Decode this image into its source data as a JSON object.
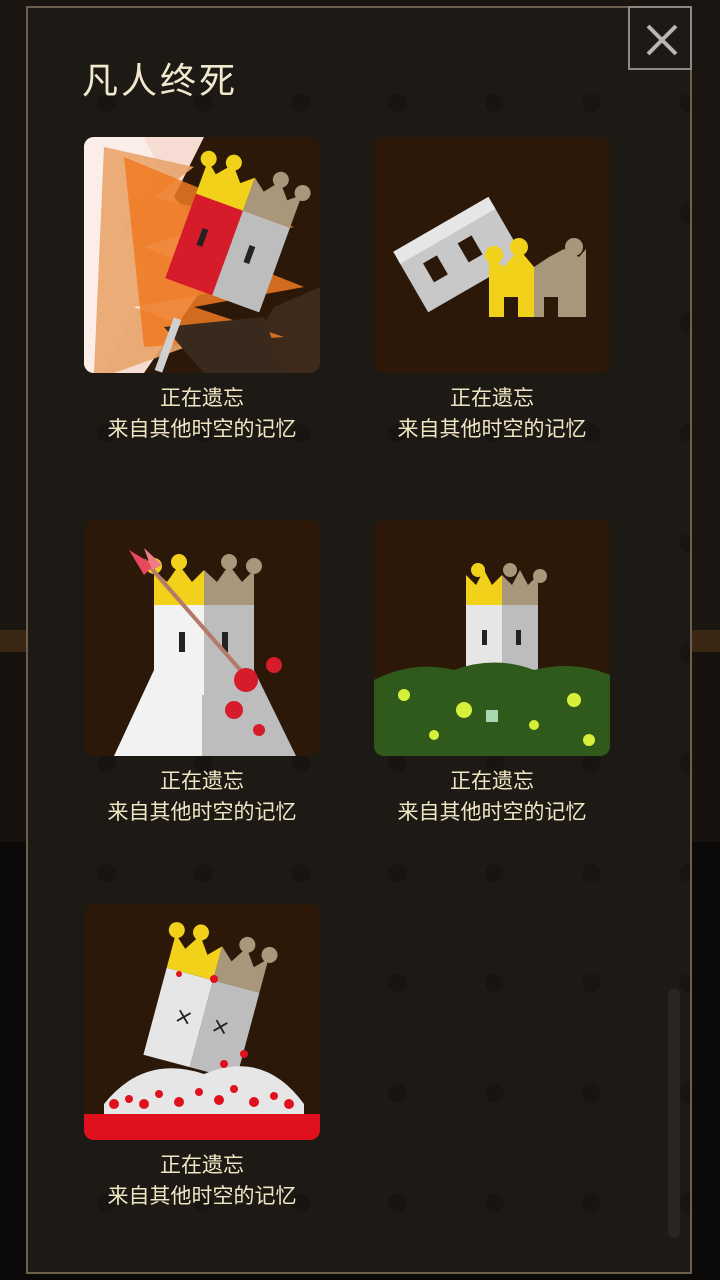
{
  "dialog": {
    "title": "凡人终死",
    "close_icon": "close-icon"
  },
  "deaths": [
    {
      "status": "正在遗忘",
      "subtitle": "来自其他时空的记忆",
      "art": "fire-death-art"
    },
    {
      "status": "正在遗忘",
      "subtitle": "来自其他时空的记忆",
      "art": "fallen-head-art"
    },
    {
      "status": "正在遗忘",
      "subtitle": "来自其他时空的记忆",
      "art": "arrow-death-art"
    },
    {
      "status": "正在遗忘",
      "subtitle": "来自其他时空的记忆",
      "art": "swamp-death-art"
    },
    {
      "status": "正在遗忘",
      "subtitle": "来自其他时空的记忆",
      "art": "ant-death-art"
    }
  ],
  "colors": {
    "panel_border": "#6e5e4c",
    "text": "#f1e6c4",
    "card_bg": "#2b1808",
    "crown_gold": "#f2d11a",
    "crown_tan": "#a8977a"
  }
}
